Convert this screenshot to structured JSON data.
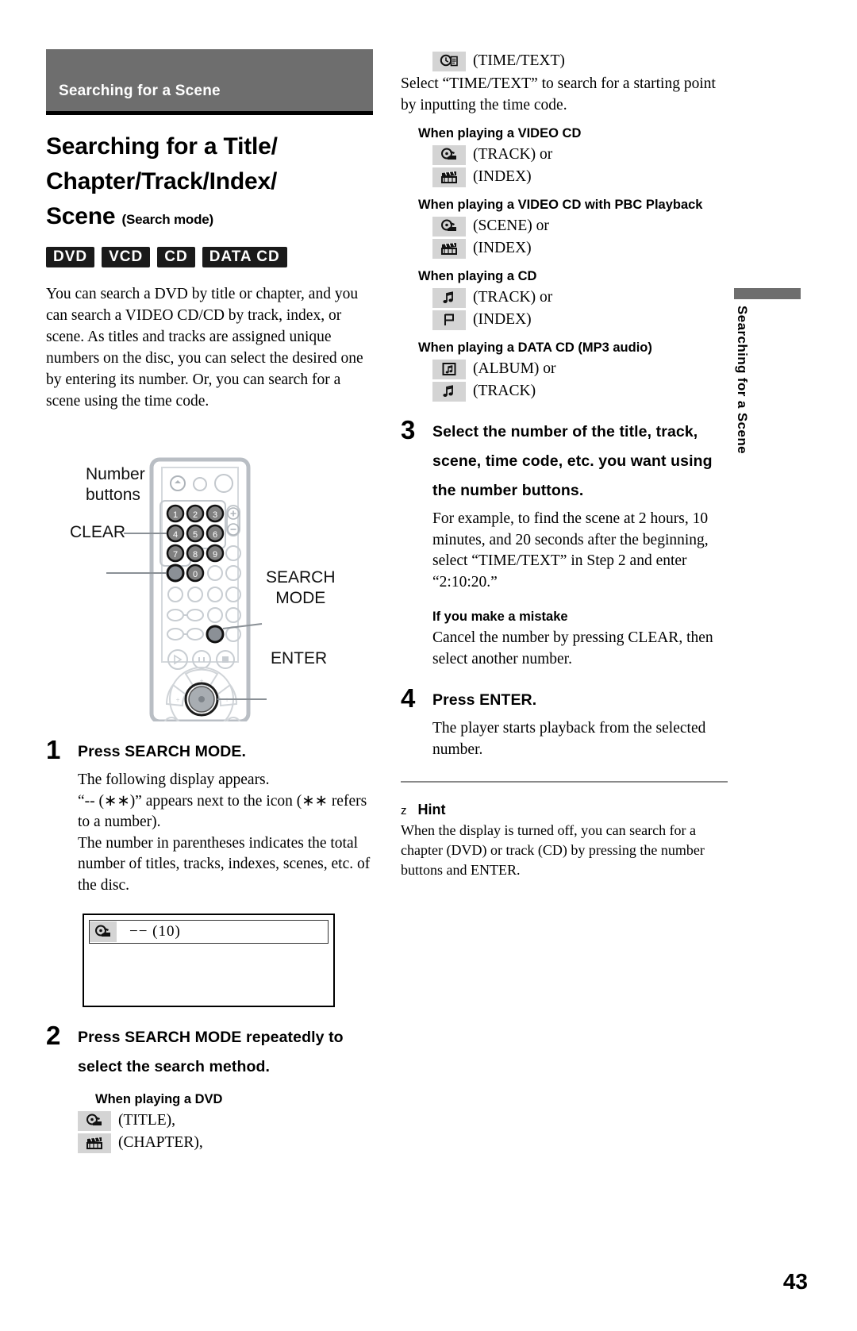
{
  "section": {
    "title": "Searching for a Scene"
  },
  "page": {
    "number": "43"
  },
  "side_tab": {
    "text": "Searching for a Scene"
  },
  "title": {
    "line1": "Searching for a Title/",
    "line2": "Chapter/Track/Index/",
    "line3": "Scene",
    "sub": "(Search mode)"
  },
  "badges": [
    {
      "label": "DVD",
      "name": "dvd"
    },
    {
      "label": "VCD",
      "name": "vcd"
    },
    {
      "label": "CD",
      "name": "cd"
    },
    {
      "label": "DATA CD",
      "name": "data-cd"
    }
  ],
  "intro": "You can search a DVD by title or chapter, and you can search a VIDEO CD/CD by track, index, or scene. As titles and tracks are assigned unique numbers on the disc, you can select the desired one by entering its number. Or, you can search for a scene using the time code.",
  "remote": {
    "callouts": {
      "number_buttons_line1": "Number",
      "number_buttons_line2": "buttons",
      "clear": "CLEAR",
      "search_mode_line1": "SEARCH",
      "search_mode_line2": "MODE",
      "enter": "ENTER"
    },
    "keypad": [
      "1",
      "2",
      "3",
      "4",
      "5",
      "6",
      "7",
      "8",
      "9",
      "0"
    ]
  },
  "steps": [
    {
      "number": "1",
      "heading": "Press SEARCH MODE.",
      "text": "The following display appears.\n“-- (∗∗)” appears next to the icon (∗∗ refers to a number).\nThe number in parentheses indicates the total number of titles, tracks, indexes, scenes, etc. of the disc."
    },
    {
      "number": "2",
      "heading": "Press SEARCH MODE repeatedly to select the search method."
    },
    {
      "number": "3",
      "heading": "Select the number of the title, track, scene, time code, etc. you want using the number buttons.",
      "text": "For example, to find the scene at 2 hours, 10 minutes, and 20 seconds after the beginning, select “TIME/TEXT” in Step 2 and enter “2:10:20.”"
    },
    {
      "number": "4",
      "heading": "Press ENTER.",
      "text": "The player starts playback from the selected number."
    }
  ],
  "display_mock": {
    "icon": "title-icon",
    "text": "−− (10)"
  },
  "search_modes": [
    {
      "group": "When playing a DVD",
      "indent": true,
      "items": [
        {
          "icon": "title-icon",
          "label": "(TITLE),"
        },
        {
          "icon": "chapter-icon",
          "label": "(CHAPTER),"
        },
        {
          "icon": "time-text-icon",
          "label": "(TIME/TEXT)"
        }
      ],
      "note": "Select “TIME/TEXT” to search for a starting point by inputting the time code."
    },
    {
      "group": "When playing a VIDEO CD",
      "indent": true,
      "items": [
        {
          "icon": "title-icon",
          "label": "(TRACK) or"
        },
        {
          "icon": "chapter-icon",
          "label": "(INDEX)"
        }
      ]
    },
    {
      "group": "When playing a VIDEO CD with PBC Playback",
      "indent": true,
      "items": [
        {
          "icon": "title-icon",
          "label": "(SCENE) or"
        },
        {
          "icon": "chapter-icon",
          "label": "(INDEX)"
        }
      ]
    },
    {
      "group": "When playing a CD",
      "indent": true,
      "items": [
        {
          "icon": "note-icon",
          "label": "(TRACK) or"
        },
        {
          "icon": "flag-icon",
          "label": "(INDEX)"
        }
      ]
    },
    {
      "group": "When playing a DATA CD (MP3 audio)",
      "indent": true,
      "items": [
        {
          "icon": "album-icon",
          "label": "(ALBUM) or"
        },
        {
          "icon": "note-icon",
          "label": "(TRACK)"
        }
      ]
    }
  ],
  "mistake": {
    "heading": "If you make a mistake",
    "text": "Cancel the number by pressing CLEAR, then select another number."
  },
  "hint": {
    "marker": "z",
    "heading": "Hint",
    "text": "When the display is turned off, you can search for a chapter (DVD) or track (CD) by pressing the number buttons and ENTER."
  },
  "colors": {
    "section_bar": "#6e6e6e",
    "badge_bg": "#1a1a1a",
    "icon_bg": "#d4d4d4"
  }
}
